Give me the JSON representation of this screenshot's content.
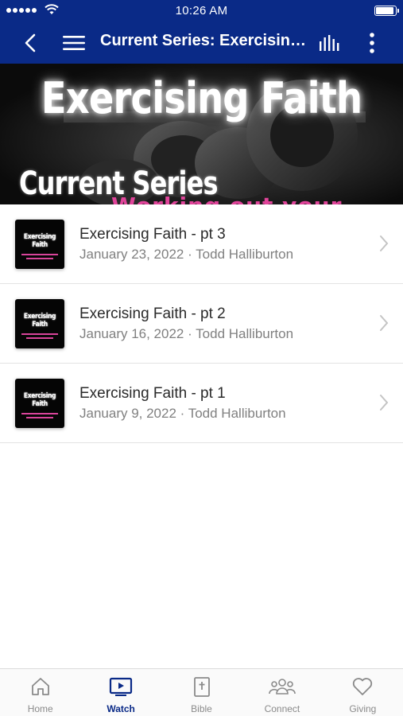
{
  "status_bar": {
    "time": "10:26 AM"
  },
  "nav": {
    "title": "Current Series: Exercising Faith",
    "back_icon": "chevron-left-icon",
    "menu_icon": "hamburger-icon",
    "audio_icon": "audio-bars-icon",
    "more_icon": "more-vertical-icon"
  },
  "hero": {
    "title": "Exercising Faith",
    "subtitle": "Current Series",
    "tagline": "Working out your faith"
  },
  "episodes": [
    {
      "title": "Exercising Faith - pt 3",
      "meta": "January 23, 2022 · Todd Halliburton",
      "thumb_title": "Exercising Faith"
    },
    {
      "title": "Exercising Faith - pt 2",
      "meta": "January 16, 2022 · Todd Halliburton",
      "thumb_title": "Exercising Faith"
    },
    {
      "title": "Exercising Faith - pt 1",
      "meta": "January 9, 2022 · Todd Halliburton",
      "thumb_title": "Exercising Faith"
    }
  ],
  "tabs": [
    {
      "label": "Home",
      "icon": "home-icon"
    },
    {
      "label": "Watch",
      "icon": "tv-play-icon",
      "active": true
    },
    {
      "label": "Bible",
      "icon": "bible-icon"
    },
    {
      "label": "Connect",
      "icon": "people-icon"
    },
    {
      "label": "Giving",
      "icon": "heart-icon"
    }
  ],
  "colors": {
    "brand": "#0a2a87",
    "accent_pink": "#e0449a",
    "muted": "#8a8a8a"
  }
}
